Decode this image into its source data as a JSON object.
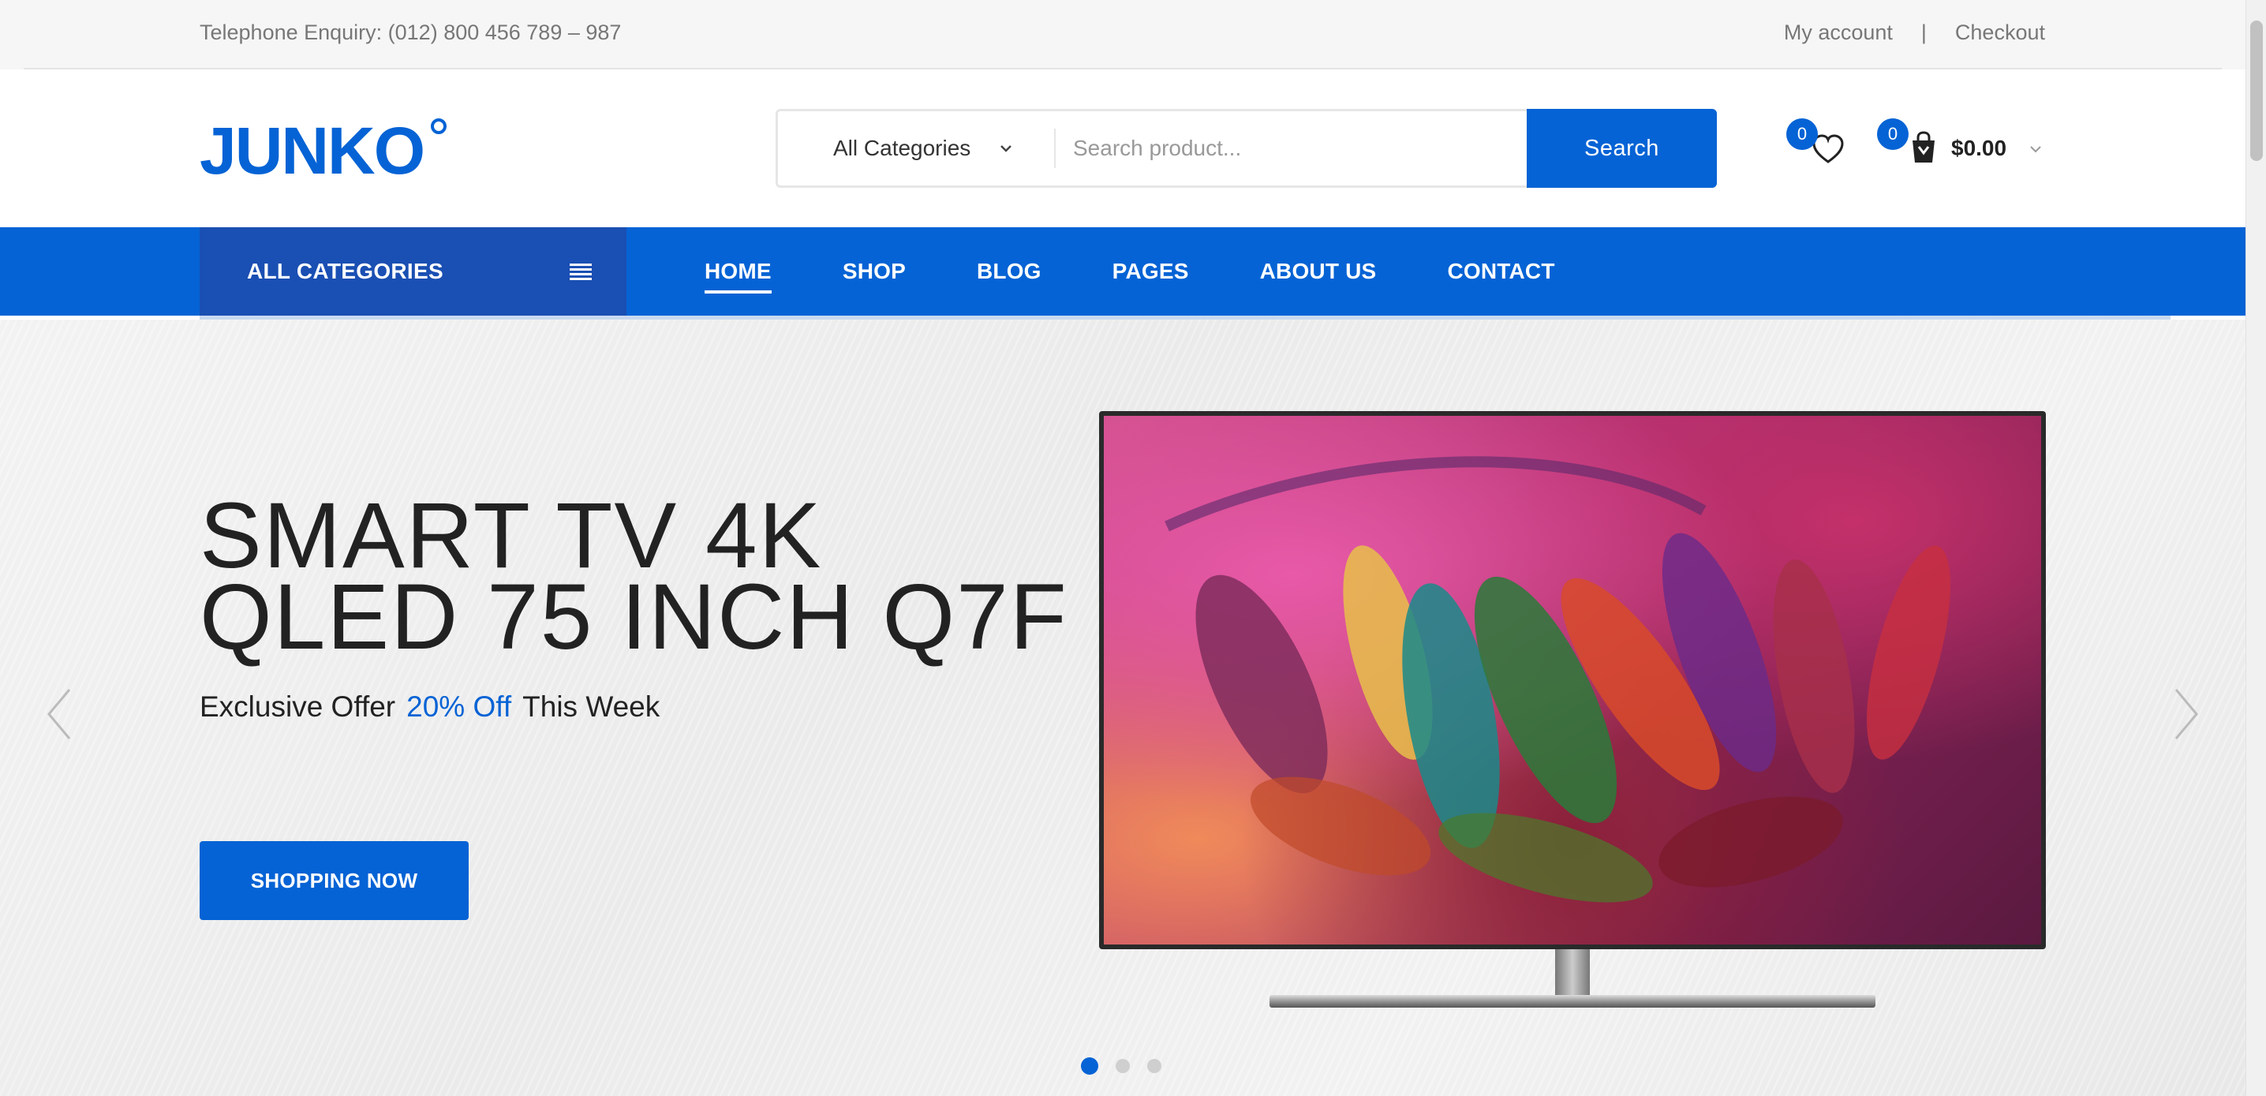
{
  "topbar": {
    "telephone": "Telephone Enquiry: (012) 800 456 789 – 987",
    "my_account": "My account",
    "separator": "|",
    "checkout": "Checkout"
  },
  "header": {
    "logo_text": "JUNKO",
    "category_select": "All Categories",
    "search_placeholder": "Search product...",
    "search_button": "Search",
    "wishlist_count": "0",
    "cart_count": "0",
    "cart_total": "$0.00"
  },
  "nav": {
    "all_categories": "ALL CATEGORIES",
    "items": [
      {
        "label": "HOME",
        "active": true
      },
      {
        "label": "SHOP"
      },
      {
        "label": "BLOG"
      },
      {
        "label": "PAGES"
      },
      {
        "label": "ABOUT US"
      },
      {
        "label": "CONTACT"
      }
    ]
  },
  "hero": {
    "title_line1": "SMART TV 4K",
    "title_line2": "QLED 75 INCH Q7F",
    "sub_prefix": "Exclusive Offer",
    "sub_highlight": "20% Off",
    "sub_suffix": "This Week",
    "button": "SHOPPING NOW",
    "slide_count": 3,
    "active_slide": 1
  },
  "colors": {
    "brand": "#0563d5",
    "nav_dark": "#1a4fb3",
    "text": "#222222"
  },
  "icons": [
    "chevron-down-icon",
    "hamburger-icon",
    "heart-icon",
    "cart-icon",
    "arrow-left-icon",
    "arrow-right-icon"
  ]
}
